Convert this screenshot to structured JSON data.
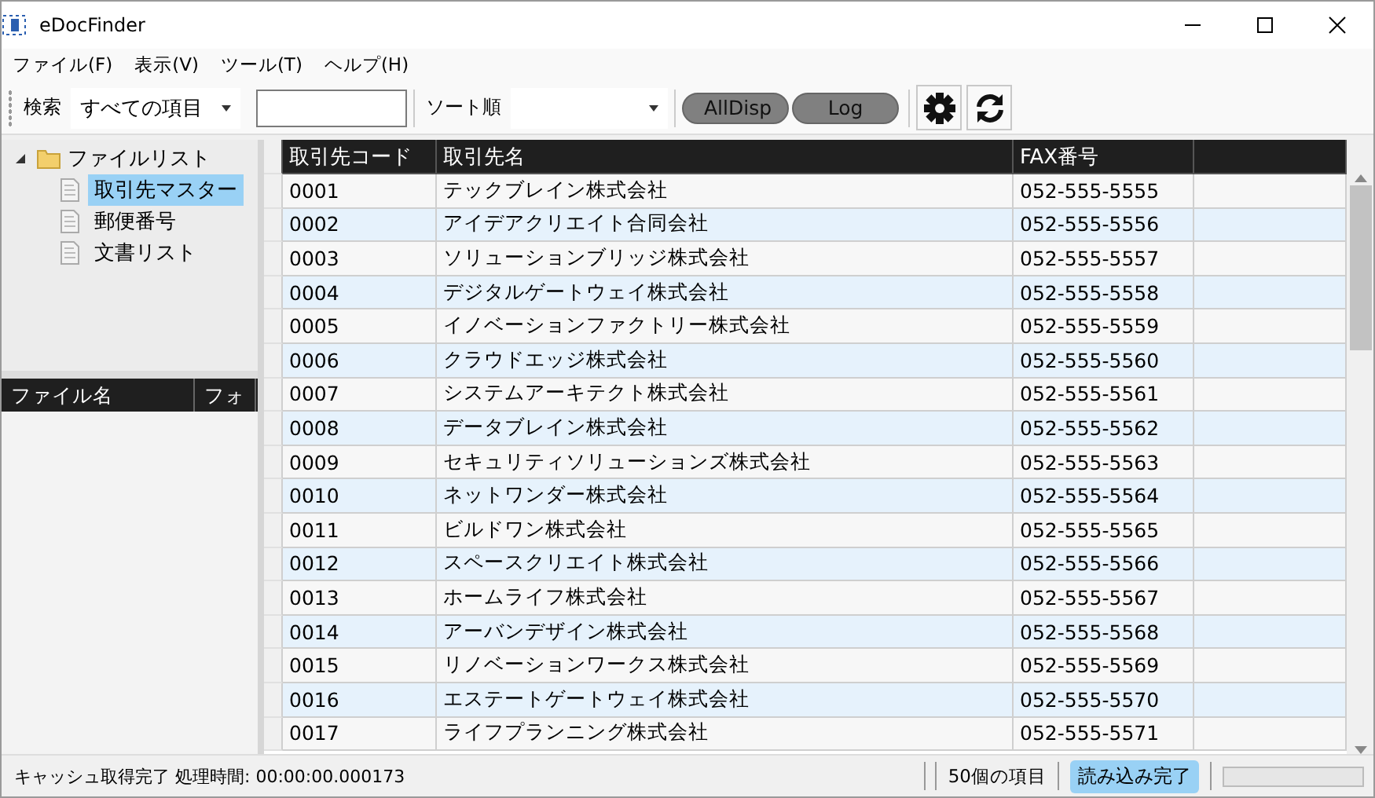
{
  "window": {
    "title": "eDocFinder"
  },
  "menu": [
    "ファイル(F)",
    "表示(V)",
    "ツール(T)",
    "ヘルプ(H)"
  ],
  "toolbar": {
    "search_label": "検索",
    "search_scope": "すべての項目",
    "sort_label": "ソート順",
    "buttons": [
      "AllDisp",
      "Log"
    ]
  },
  "tree": [
    {
      "label": "ファイルリスト",
      "expanded": true,
      "children": [
        {
          "label": "取引先マスター",
          "selected": true
        },
        {
          "label": "郵便番号",
          "selected": false
        },
        {
          "label": "文書リスト",
          "selected": false
        }
      ]
    }
  ],
  "file_table": {
    "columns": [
      "ファイル名",
      "フォ"
    ]
  },
  "table": {
    "columns": [
      "取引先コード",
      "取引先名",
      "FAX番号"
    ],
    "rows": [
      [
        "0001",
        "テックブレイン株式会社",
        "052-555-5555"
      ],
      [
        "0002",
        "アイデアクリエイト合同会社",
        "052-555-5556"
      ],
      [
        "0003",
        "ソリューションブリッジ株式会社",
        "052-555-5557"
      ],
      [
        "0004",
        "デジタルゲートウェイ株式会社",
        "052-555-5558"
      ],
      [
        "0005",
        "イノベーションファクトリー株式会社",
        "052-555-5559"
      ],
      [
        "0006",
        "クラウドエッジ株式会社",
        "052-555-5560"
      ],
      [
        "0007",
        "システムアーキテクト株式会社",
        "052-555-5561"
      ],
      [
        "0008",
        "データブレイン株式会社",
        "052-555-5562"
      ],
      [
        "0009",
        "セキュリティソリューションズ株式会社",
        "052-555-5563"
      ],
      [
        "0010",
        "ネットワンダー株式会社",
        "052-555-5564"
      ],
      [
        "0011",
        "ビルドワン株式会社",
        "052-555-5565"
      ],
      [
        "0012",
        "スペースクリエイト株式会社",
        "052-555-5566"
      ],
      [
        "0013",
        "ホームライフ株式会社",
        "052-555-5567"
      ],
      [
        "0014",
        "アーバンデザイン株式会社",
        "052-555-5568"
      ],
      [
        "0015",
        "リノベーションワークス株式会社",
        "052-555-5569"
      ],
      [
        "0016",
        "エステートゲートウェイ株式会社",
        "052-555-5570"
      ],
      [
        "0017",
        "ライフプランニング株式会社",
        "052-555-5571"
      ]
    ]
  },
  "status_bar": {
    "message": "キャッシュ取得完了 処理時間: 00:00:00.000173",
    "count": "50個の項目",
    "state": "読み込み完了",
    "progress": {
      "level": 0
    }
  }
}
